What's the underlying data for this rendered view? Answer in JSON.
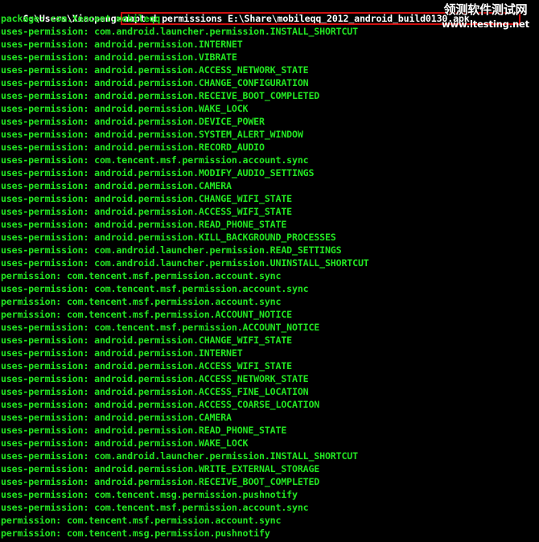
{
  "prompt": {
    "path": "C:\\Users\\Xiaopeng>",
    "command": "aapt d permissions E:\\Share\\mobileqq_2012_android_build0130.apk"
  },
  "watermark": {
    "cn": "领测软件测试网",
    "url": "www.ltesting.net"
  },
  "output_lines": [
    "package: com.tencent.mobileqq",
    "uses-permission: com.android.launcher.permission.INSTALL_SHORTCUT",
    "uses-permission: android.permission.INTERNET",
    "uses-permission: android.permission.VIBRATE",
    "uses-permission: android.permission.ACCESS_NETWORK_STATE",
    "uses-permission: android.permission.CHANGE_CONFIGURATION",
    "uses-permission: android.permission.RECEIVE_BOOT_COMPLETED",
    "uses-permission: android.permission.WAKE_LOCK",
    "uses-permission: android.permission.DEVICE_POWER",
    "uses-permission: android.permission.SYSTEM_ALERT_WINDOW",
    "uses-permission: android.permission.RECORD_AUDIO",
    "uses-permission: com.tencent.msf.permission.account.sync",
    "uses-permission: android.permission.MODIFY_AUDIO_SETTINGS",
    "uses-permission: android.permission.CAMERA",
    "uses-permission: android.permission.CHANGE_WIFI_STATE",
    "uses-permission: android.permission.ACCESS_WIFI_STATE",
    "uses-permission: android.permission.READ_PHONE_STATE",
    "uses-permission: android.permission.KILL_BACKGROUND_PROCESSES",
    "uses-permission: com.android.launcher.permission.READ_SETTINGS",
    "uses-permission: com.android.launcher.permission.UNINSTALL_SHORTCUT",
    "permission: com.tencent.msf.permission.account.sync",
    "uses-permission: com.tencent.msf.permission.account.sync",
    "permission: com.tencent.msf.permission.account.sync",
    "permission: com.tencent.msf.permission.ACCOUNT_NOTICE",
    "uses-permission: com.tencent.msf.permission.ACCOUNT_NOTICE",
    "uses-permission: android.permission.CHANGE_WIFI_STATE",
    "uses-permission: android.permission.INTERNET",
    "uses-permission: android.permission.ACCESS_WIFI_STATE",
    "uses-permission: android.permission.ACCESS_NETWORK_STATE",
    "uses-permission: android.permission.ACCESS_FINE_LOCATION",
    "uses-permission: android.permission.ACCESS_COARSE_LOCATION",
    "uses-permission: android.permission.CAMERA",
    "uses-permission: android.permission.READ_PHONE_STATE",
    "uses-permission: android.permission.WAKE_LOCK",
    "uses-permission: com.android.launcher.permission.INSTALL_SHORTCUT",
    "uses-permission: android.permission.WRITE_EXTERNAL_STORAGE",
    "uses-permission: android.permission.RECEIVE_BOOT_COMPLETED",
    "uses-permission: com.tencent.msg.permission.pushnotify",
    "uses-permission: com.tencent.msf.permission.account.sync",
    "permission: com.tencent.msf.permission.account.sync",
    "permission: com.tencent.msg.permission.pushnotify"
  ]
}
